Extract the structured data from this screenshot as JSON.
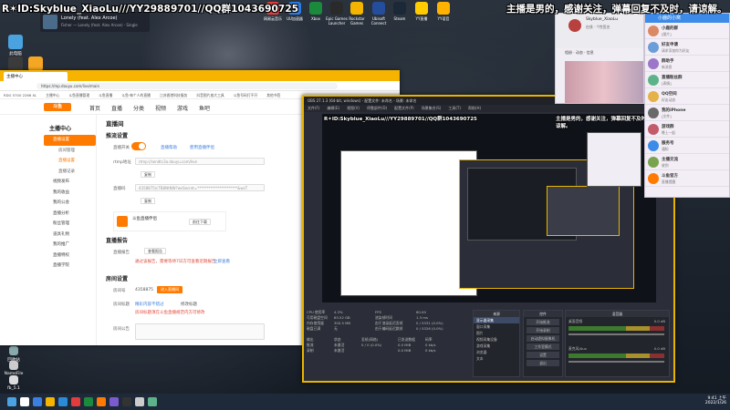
{
  "overlay": {
    "left_banner": "R✶ID:Skyblue_XiaoLu///YY29889701//QQ群1043690725",
    "right_banner": "主播是男的，感谢关注，弹幕回复不及时，请谅解。"
  },
  "desktop_icons": [
    {
      "label": "此电脑"
    },
    {
      "label": "LANDrop"
    },
    {
      "label": "OBS"
    },
    {
      "label": "回收站"
    },
    {
      "label": "NameFile"
    },
    {
      "label": "fb_5.1"
    },
    {
      "label": "myfile"
    }
  ],
  "top_tray": [
    {
      "label": "网易云音乐",
      "color": "#e23c3c"
    },
    {
      "label": "UU加速器",
      "color": "#2b7ce9"
    },
    {
      "label": "Xbox",
      "color": "#1b8a3c"
    },
    {
      "label": "Epic Games Launcher",
      "color": "#2a2a2a"
    },
    {
      "label": "Rockstar Games",
      "color": "#f4b400"
    },
    {
      "label": "Ubisoft Connect",
      "color": "#244e9c"
    },
    {
      "label": "Steam",
      "color": "#1b2838"
    },
    {
      "label": "YY直播",
      "color": "#ffcc00"
    },
    {
      "label": "YY语音",
      "color": "#ffb300"
    }
  ],
  "media": {
    "title": "Lonely (feat. Alex Arcoe)",
    "subtitle": "Fisher — Lonely (feat. Alex Arcoe) · Single"
  },
  "browser": {
    "tab_title": "主播中心",
    "url": "https://mp.douyu.com/live/main",
    "bookmarks": [
      "RDG 5700 2266 XL",
      "主播中心",
      "斗鱼直播管理",
      "斗鱼直播",
      "斗鱼·每个人的直播",
      "江苏香港科技服务",
      "抖音图片放大工具",
      "斗鱼号码打不开",
      "其他书签"
    ],
    "site_logo": "斗鱼",
    "nav": [
      "首页",
      "直播",
      "分类",
      "视频",
      "游戏",
      "鱼吧"
    ],
    "sidebar_title": "主播中心",
    "sidebar_items": [
      {
        "label": "直播设置",
        "active": true,
        "sub": false
      },
      {
        "label": "房间管理",
        "active": false,
        "sub": true
      },
      {
        "label": "直播设置",
        "active": true,
        "sub": true
      },
      {
        "label": "直播记录",
        "active": false,
        "sub": true
      },
      {
        "label": "视频发布",
        "active": false,
        "sub": false
      },
      {
        "label": "我的收益",
        "active": false,
        "sub": false
      },
      {
        "label": "我的公会",
        "active": false,
        "sub": false
      },
      {
        "label": "直播分析",
        "active": false,
        "sub": false
      },
      {
        "label": "粉丝管理",
        "active": false,
        "sub": false
      },
      {
        "label": "道具礼物",
        "active": false,
        "sub": false
      },
      {
        "label": "我的推广",
        "active": false,
        "sub": false
      },
      {
        "label": "直播特权",
        "active": false,
        "sub": false
      },
      {
        "label": "直播学院",
        "active": false,
        "sub": false
      }
    ],
    "content": {
      "breadcrumb": "直播间",
      "section1": "推流设置",
      "push_label": "直播开关",
      "push_link1": "直播帮助",
      "push_link2": "使用直播伴侣",
      "rtmp_label": "rtmp地址",
      "rtmp_value": "rtmp://sendtc3a.douyu.com/live",
      "copy1": "复制",
      "code_label": "直播码",
      "code_value": "4358875/cTB8NtNW?wsSecret=**********************&wsT",
      "copy2": "复制",
      "promo_title": "斗鱼直播伴侣",
      "promo_btn": "前往下载",
      "section2": "直播报告",
      "report_label": "直播报告",
      "report_btn": "查看报告",
      "report_red": "通过该报告，需要等待7日方可查看近期报告",
      "report_link": "立即查看",
      "section3": "房间设置",
      "room_label": "房间号",
      "room_value": "4358875",
      "room_btn": "进入直播间",
      "title_label": "房间标题",
      "title_value": "精彩内容不错过",
      "title_hint": "修改标题",
      "title_red": "房间标题须在斗鱼直播规范内方可修改",
      "notice_label": "房间公告",
      "category_label": "直播分类"
    }
  },
  "obs": {
    "title": "OBS 27.1.3 (64-bit, windows) - 配置文件: 未命名 - 场景: 未命名",
    "menu": [
      "文件(F)",
      "编辑(E)",
      "视图(V)",
      "停靠部件(D)",
      "配置文件(P)",
      "场景集合(S)",
      "工具(T)",
      "帮助(H)"
    ],
    "stats": [
      [
        "CPU 使用率",
        "4.3%",
        "FPS",
        "60.00"
      ],
      [
        "可用磁盘空间",
        "83.52 GB",
        "渲染帧时间",
        "1.3 ms"
      ],
      [
        "内存使用量",
        "300.5 MB",
        "由于渲染延迟丢帧",
        "0 / 5331 (0.0%)"
      ],
      [
        "磁盘已满",
        "无",
        "由于编码延迟跳帧",
        "0 / 5326 (0.0%)"
      ]
    ],
    "outputs": {
      "headers": [
        "输出",
        "状态",
        "丢帧(网络)",
        "已发送数据",
        "码率"
      ],
      "rows": [
        [
          "推流",
          "未激活",
          "0 / 0 (0.0%)",
          "0.0 MiB",
          "0 kb/s"
        ],
        [
          "录制",
          "未激活",
          "",
          "0.0 MiB",
          "0 kb/s"
        ]
      ]
    },
    "sources_title": "来源",
    "sources": [
      "显示器采集",
      "窗口采集",
      "图片",
      "视频采集设备",
      "游戏采集",
      "浏览器",
      "文本"
    ],
    "mixer_title": "混音器",
    "mixer": [
      {
        "name": "桌面音频",
        "db": "0.0 dB"
      },
      {
        "name": "麦克风/Aux",
        "db": "0.0 dB"
      }
    ],
    "controls_title": "控件",
    "controls": [
      "开始推流",
      "开始录制",
      "启动虚拟摄像机",
      "工作室模式",
      "设置",
      "退出"
    ]
  },
  "chat_window": {
    "name": "Skyblue_XiaoLu",
    "subtitle": "在线 · 个性签名",
    "tabs": "相册 · 动态 · 信息",
    "gallery_label": "相册"
  },
  "chat_panel": {
    "title": "小鹿的小窝",
    "items": [
      {
        "name": "小鹿的群",
        "msg": "[图片]",
        "color": "#d98a64"
      },
      {
        "name": "好友申请",
        "msg": "请求添加你为好友",
        "color": "#6b9ed9"
      },
      {
        "name": "群助手",
        "msg": "新消息",
        "color": "#9c76c9"
      },
      {
        "name": "直播粉丝群",
        "msg": "[表情]",
        "color": "#5cb38a"
      },
      {
        "name": "QQ空间",
        "msg": "好友动态",
        "color": "#e5b24a"
      },
      {
        "name": "我的iPhone",
        "msg": "[文件]",
        "color": "#6a6a6a"
      },
      {
        "name": "游戏群",
        "msg": "晚上一起",
        "color": "#c25b6a"
      },
      {
        "name": "服务号",
        "msg": "通知",
        "color": "#3d8be8"
      },
      {
        "name": "主播交流",
        "msg": "收到",
        "color": "#7aa34e"
      },
      {
        "name": "斗鱼官方",
        "msg": "直播提醒",
        "color": "#ff7a00"
      }
    ]
  },
  "taskbar": {
    "time": "9:41 上午",
    "date": "2022/1/26"
  }
}
